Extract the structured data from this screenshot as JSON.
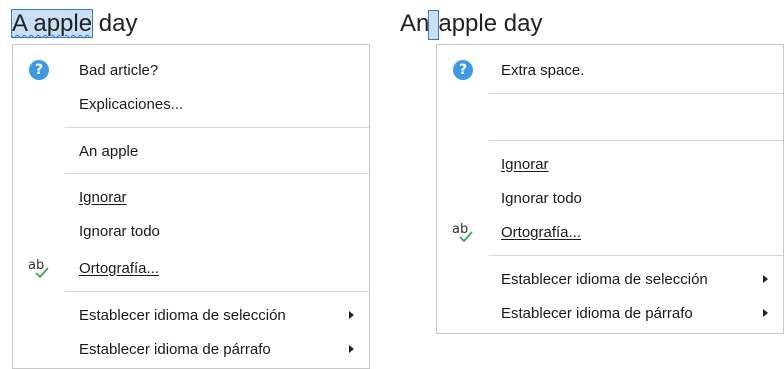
{
  "left": {
    "doc_words": [
      "A apple",
      "day"
    ],
    "menu": {
      "suggestion_title": "Bad article?",
      "explanations": "Explicaciones...",
      "replacement": "An apple",
      "ignore": "Ignorar",
      "ignore_all": "Ignorar todo",
      "spelling": "Ortografía...",
      "set_selection_language": "Establecer idioma de selección",
      "set_paragraph_language": "Establecer idioma de párrafo"
    }
  },
  "right": {
    "doc_words": [
      "An",
      "apple day"
    ],
    "menu": {
      "suggestion_title": "Extra space.",
      "ignore": "Ignorar",
      "ignore_all": "Ignorar todo",
      "spelling": "Ortografía...",
      "set_selection_language": "Establecer idioma de selección",
      "set_paragraph_language": "Establecer idioma de párrafo"
    }
  },
  "colors": {
    "help_icon": "#3c99e6",
    "selection": "#c9dff5",
    "squiggle": "#3a6fd6",
    "spell_icon_check": "#3fa35a"
  },
  "icons": [
    "help-icon",
    "spellcheck-icon",
    "submenu-arrow-icon"
  ]
}
